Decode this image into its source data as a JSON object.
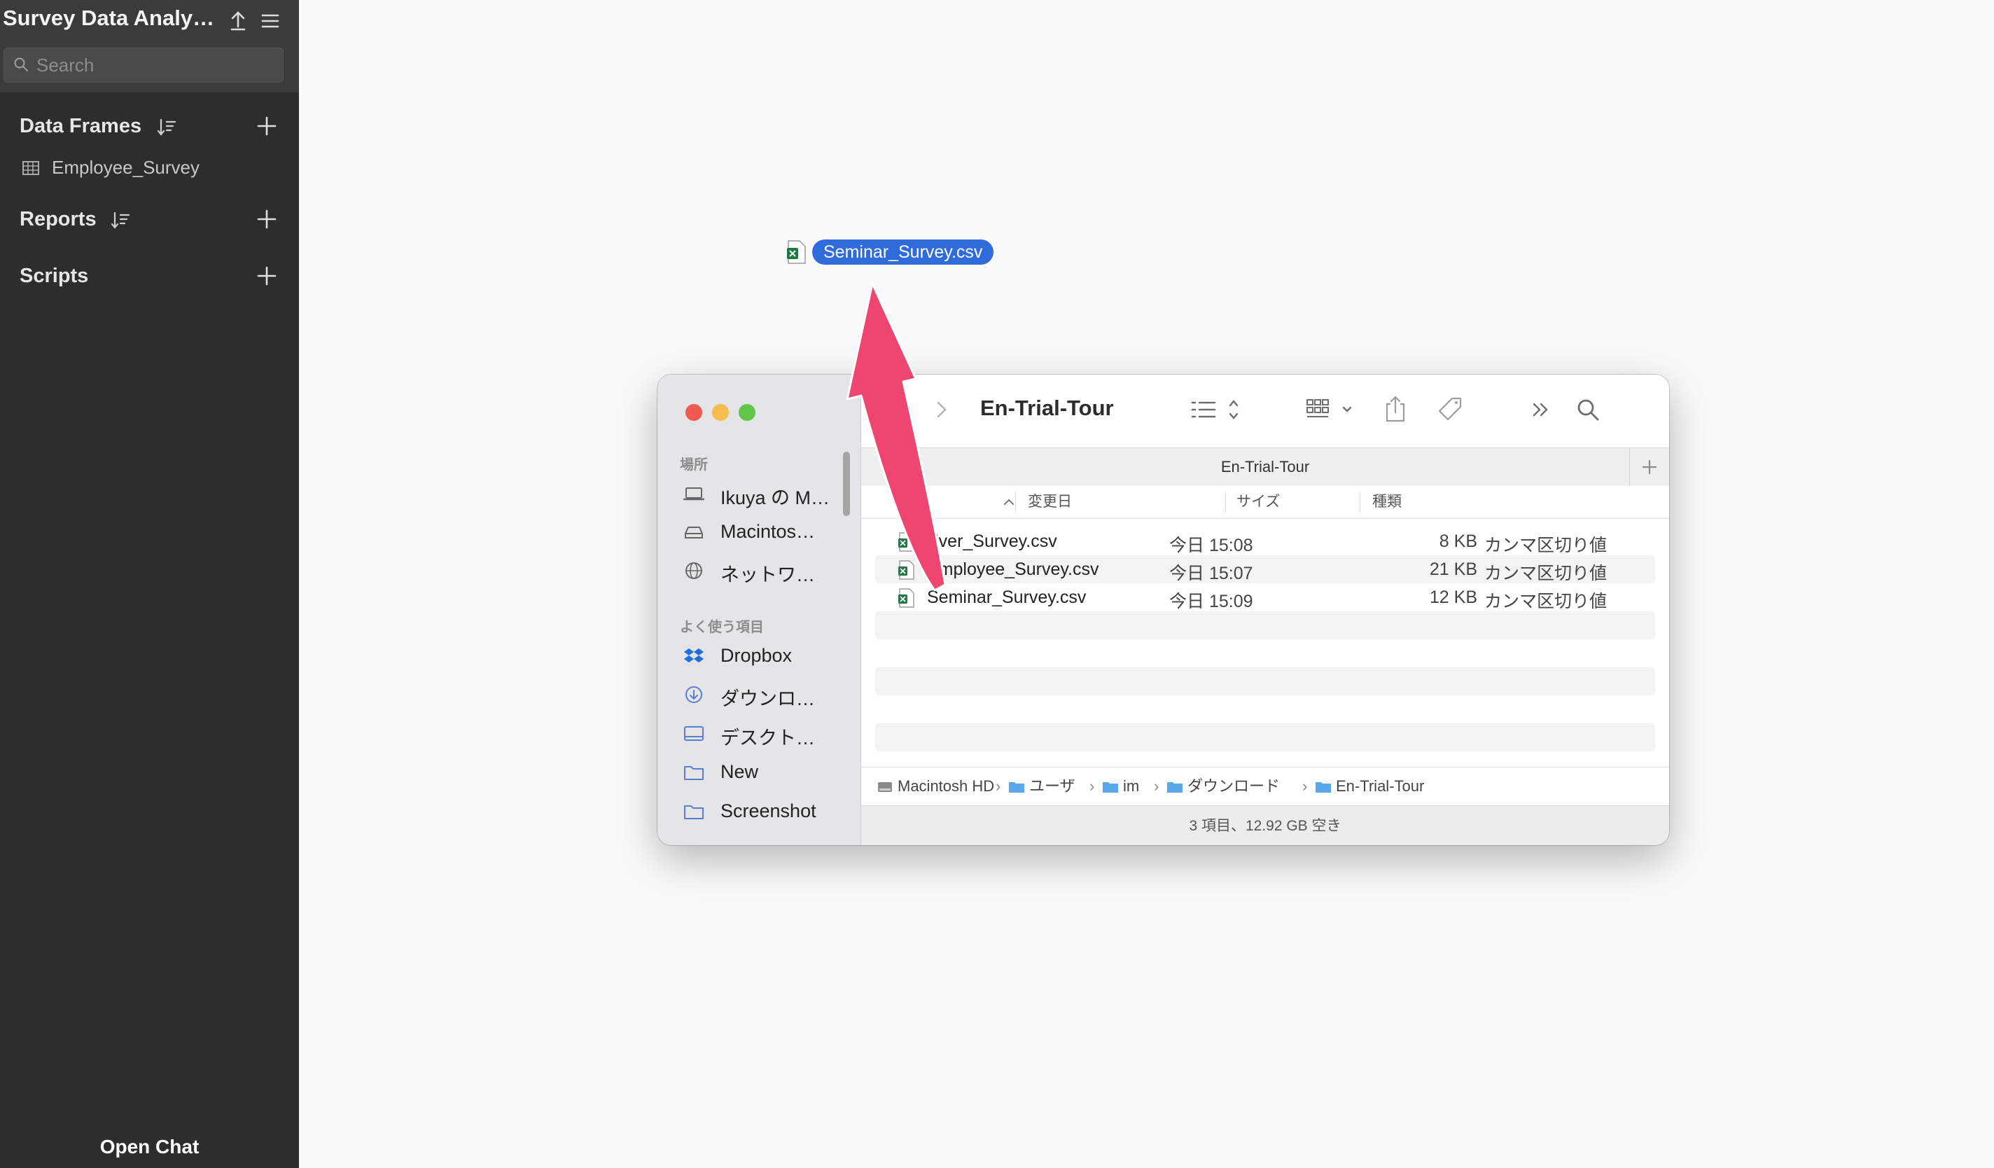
{
  "app": {
    "title": "Survey Data Analy…",
    "search_placeholder": "Search",
    "sections": [
      {
        "label": "Data Frames",
        "items": [
          "Employee_Survey"
        ]
      },
      {
        "label": "Reports"
      },
      {
        "label": "Scripts"
      }
    ],
    "open_chat": "Open Chat"
  },
  "drag": {
    "file_name": "Seminar_Survey.csv"
  },
  "finder": {
    "title": "En-Trial-Tour",
    "tab_title": "En-Trial-Tour",
    "sidebar": {
      "locations_header": "場所",
      "locations": [
        {
          "label": "Ikuya の M…",
          "icon": "laptop-icon"
        },
        {
          "label": "Macintos…",
          "icon": "disk-icon"
        },
        {
          "label": "ネットワ…",
          "icon": "globe-icon"
        }
      ],
      "favorites_header": "よく使う項目",
      "favorites": [
        {
          "label": "Dropbox",
          "icon": "dropbox-icon"
        },
        {
          "label": "ダウンロ…",
          "icon": "download-icon"
        },
        {
          "label": "デスクト…",
          "icon": "desktop-icon"
        },
        {
          "label": "New",
          "icon": "folder-icon"
        },
        {
          "label": "Screenshot",
          "icon": "folder-icon"
        }
      ]
    },
    "columns": {
      "name": "前",
      "date": "変更日",
      "size": "サイズ",
      "kind": "種類"
    },
    "files": [
      {
        "name": "Ever_Survey.csv",
        "date": "今日 15:08",
        "size": "8 KB",
        "kind": "カンマ区切り値"
      },
      {
        "name": "Employee_Survey.csv",
        "date": "今日 15:07",
        "size": "21 KB",
        "kind": "カンマ区切り値"
      },
      {
        "name": "Seminar_Survey.csv",
        "date": "今日 15:09",
        "size": "12 KB",
        "kind": "カンマ区切り値"
      }
    ],
    "path": [
      "Macintosh HD",
      "ユーザ",
      "im",
      "ダウンロード",
      "En-Trial-Tour"
    ],
    "status": "3 項目、12.92 GB 空き"
  },
  "colors": {
    "sidebar_bg": "#2d2d2d",
    "drag_highlight": "#2f6bdb",
    "arrow": "#ee4670",
    "traffic_red": "#ee5a52",
    "traffic_yellow": "#f5bd4f",
    "traffic_green": "#5fc64a"
  }
}
